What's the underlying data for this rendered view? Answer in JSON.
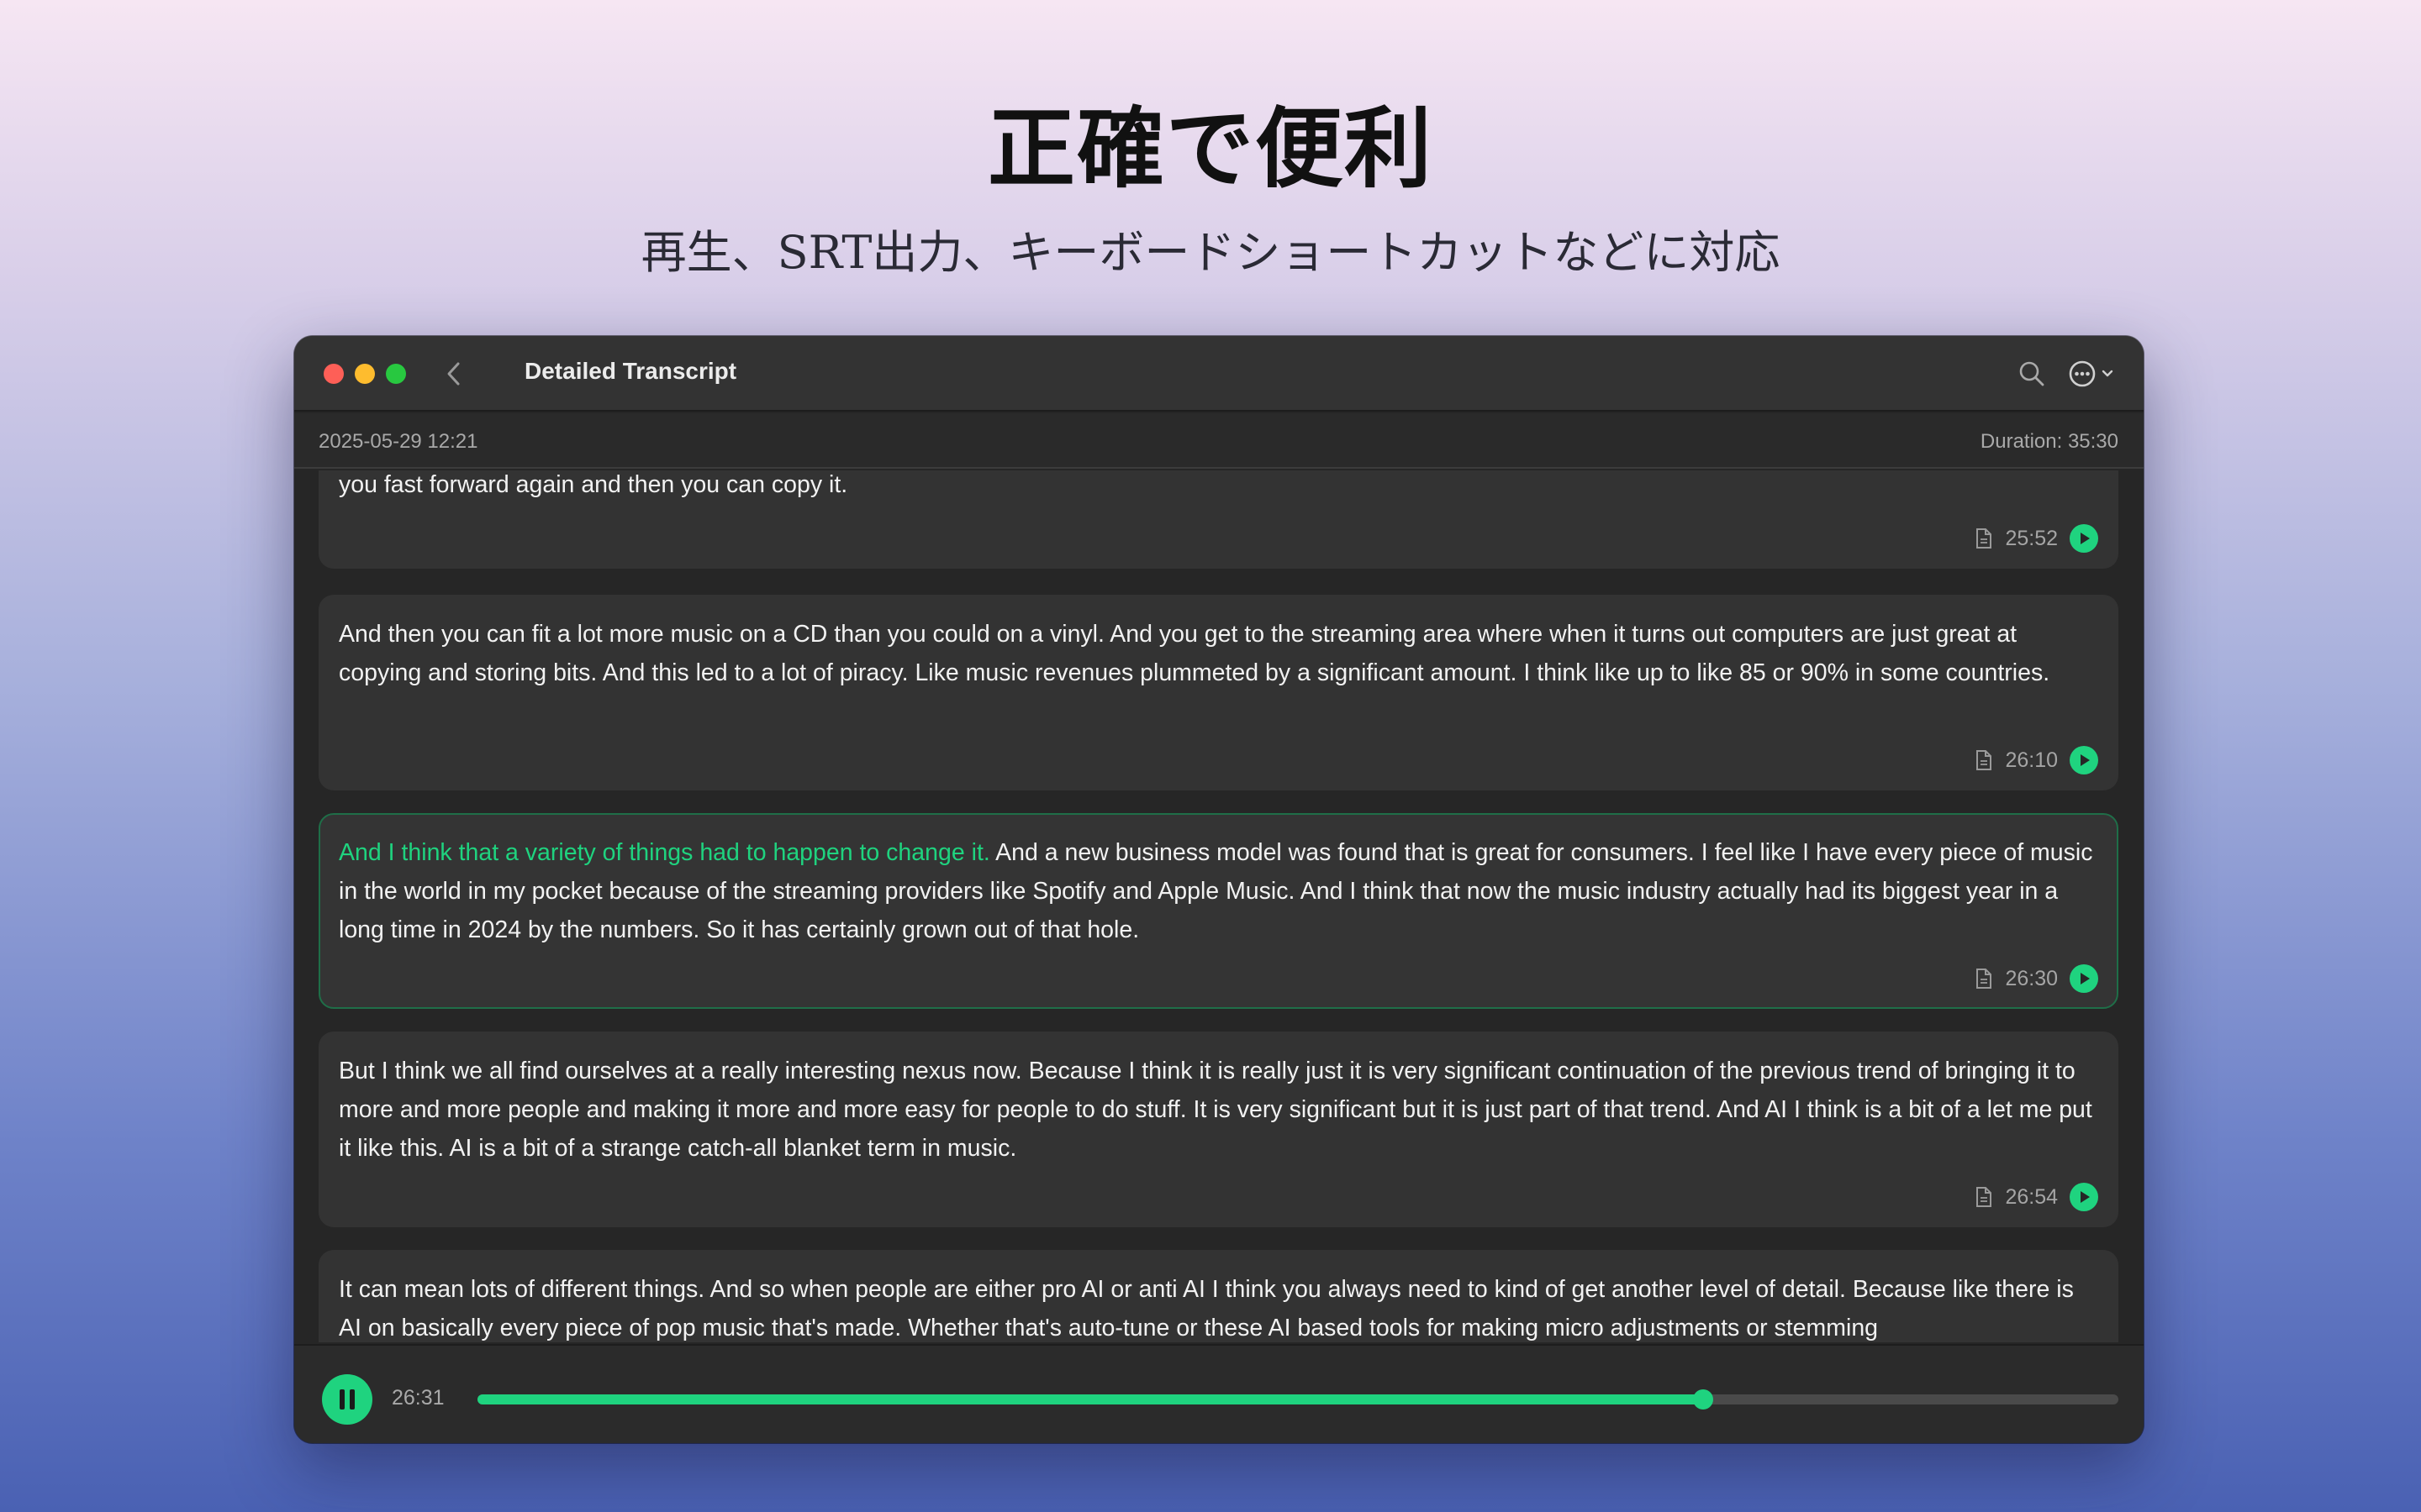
{
  "promo": {
    "headline": "正確で便利",
    "subheadline": "再生、SRT出力、キーボードショートカットなどに対応"
  },
  "window": {
    "title": "Detailed Transcript",
    "date": "2025-05-29 12:21",
    "duration": "Duration: 35:30",
    "icons": {
      "back": "chevron-left-icon",
      "search": "search-icon",
      "more": "ellipsis-circle-icon"
    }
  },
  "transcript": {
    "segments": [
      {
        "highlight": "",
        "text": "you fast forward again and then you can copy it.",
        "time": "25:52"
      },
      {
        "highlight": "",
        "text": "And then you can fit a lot more music on a CD than you could on a vinyl. And you get to the streaming area where when it turns out computers are just great at copying and storing bits. And this led to a lot of piracy. Like music revenues plummeted by a significant amount. I think like up to like 85 or 90% in some countries.",
        "time": "26:10"
      },
      {
        "highlight": "And I think that a variety of things had to happen to change it.",
        "text": " And a new business model was found that is great for consumers. I feel like I have every piece of music in the world in my pocket because of the streaming providers like Spotify and Apple Music. And I think that now the music industry actually had its biggest year in a long time in 2024 by the numbers. So it has certainly grown out of that hole.",
        "time": "26:30",
        "active": true
      },
      {
        "highlight": "",
        "text": "But I think we all find ourselves at a really interesting nexus now. Because I think it is really just it is very significant continuation of the previous trend of bringing it to more and more people and making it more and more easy for people to do stuff. It is very significant but it is just part of that trend. And AI I think is a bit of a let me put it like this. AI is a bit of a strange catch-all blanket term in music.",
        "time": "26:54"
      },
      {
        "highlight": "",
        "text": "It can mean lots of different things. And so when people are either pro AI or anti AI I think you always need to kind of get another level of detail. Because like there is AI on basically every piece of pop music that's made. Whether that's auto-tune or these AI based tools for making micro adjustments or stemming",
        "time": ""
      }
    ]
  },
  "player": {
    "current_time": "26:31",
    "progress": 0.747,
    "state": "playing",
    "accent_color": "#1fd37f"
  }
}
